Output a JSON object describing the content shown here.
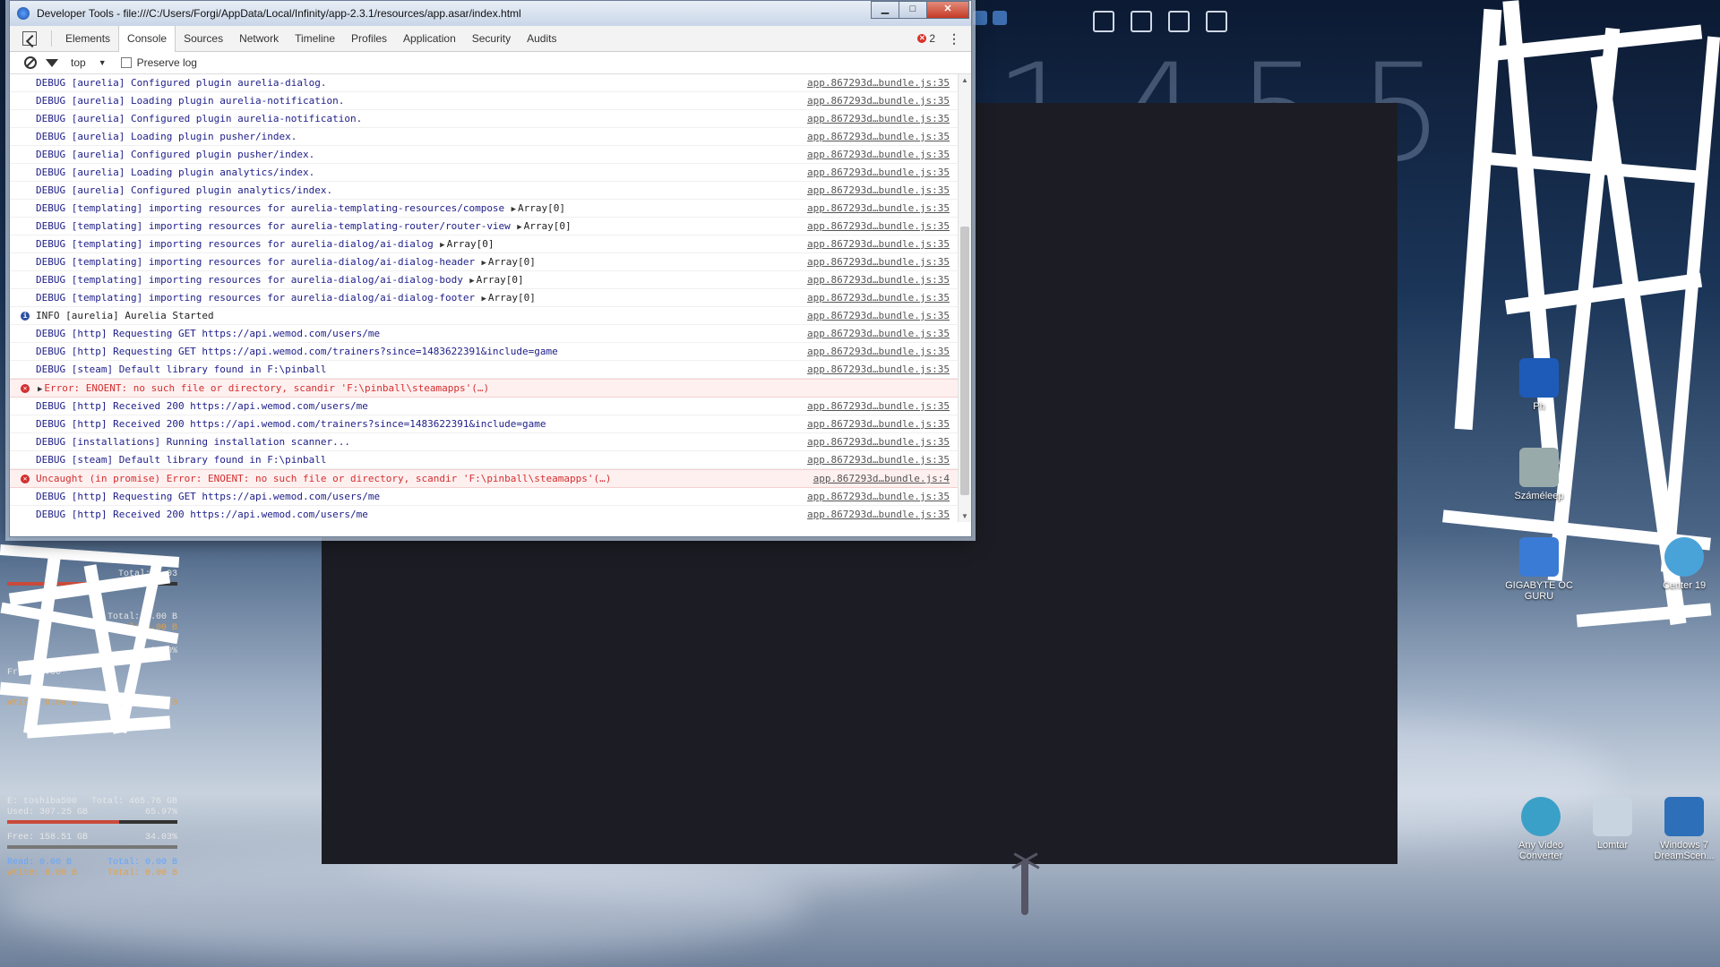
{
  "devtools": {
    "title": "Developer Tools - file:///C:/Users/Forgi/AppData/Local/Infinity/app-2.3.1/resources/app.asar/index.html",
    "window_buttons": {
      "minimize": "▁",
      "maximize": "□",
      "close": "✕"
    },
    "tabs": [
      {
        "label": "Elements"
      },
      {
        "label": "Console",
        "active": true
      },
      {
        "label": "Sources"
      },
      {
        "label": "Network"
      },
      {
        "label": "Timeline"
      },
      {
        "label": "Profiles"
      },
      {
        "label": "Application"
      },
      {
        "label": "Security"
      },
      {
        "label": "Audits"
      }
    ],
    "error_count": "2",
    "filter": {
      "context": "top",
      "preserve_log_label": "Preserve log"
    },
    "logs": [
      {
        "type": "debug",
        "text": "DEBUG [aurelia] Configured plugin aurelia-dialog.",
        "source": "app.867293d…bundle.js:35"
      },
      {
        "type": "debug",
        "text": "DEBUG [aurelia] Loading plugin aurelia-notification.",
        "source": "app.867293d…bundle.js:35"
      },
      {
        "type": "debug",
        "text": "DEBUG [aurelia] Configured plugin aurelia-notification.",
        "source": "app.867293d…bundle.js:35"
      },
      {
        "type": "debug",
        "text": "DEBUG [aurelia] Loading plugin pusher/index.",
        "source": "app.867293d…bundle.js:35"
      },
      {
        "type": "debug",
        "text": "DEBUG [aurelia] Configured plugin pusher/index.",
        "source": "app.867293d…bundle.js:35"
      },
      {
        "type": "debug",
        "text": "DEBUG [aurelia] Loading plugin analytics/index.",
        "source": "app.867293d…bundle.js:35"
      },
      {
        "type": "debug",
        "text": "DEBUG [aurelia] Configured plugin analytics/index.",
        "source": "app.867293d…bundle.js:35"
      },
      {
        "type": "debug",
        "text": "DEBUG [templating] importing resources for aurelia-templating-resources/compose",
        "extra": "Array[0]",
        "source": "app.867293d…bundle.js:35"
      },
      {
        "type": "debug",
        "text": "DEBUG [templating] importing resources for aurelia-templating-router/router-view",
        "extra": "Array[0]",
        "source": "app.867293d…bundle.js:35"
      },
      {
        "type": "debug",
        "text": "DEBUG [templating] importing resources for aurelia-dialog/ai-dialog",
        "extra": "Array[0]",
        "source": "app.867293d…bundle.js:35"
      },
      {
        "type": "debug",
        "text": "DEBUG [templating] importing resources for aurelia-dialog/ai-dialog-header",
        "extra": "Array[0]",
        "source": "app.867293d…bundle.js:35"
      },
      {
        "type": "debug",
        "text": "DEBUG [templating] importing resources for aurelia-dialog/ai-dialog-body",
        "extra": "Array[0]",
        "source": "app.867293d…bundle.js:35"
      },
      {
        "type": "debug",
        "text": "DEBUG [templating] importing resources for aurelia-dialog/ai-dialog-footer",
        "extra": "Array[0]",
        "source": "app.867293d…bundle.js:35"
      },
      {
        "type": "info",
        "text": "INFO [aurelia] Aurelia Started",
        "source": "app.867293d…bundle.js:35"
      },
      {
        "type": "debug",
        "text": "DEBUG [http] Requesting GET https://api.wemod.com/users/me",
        "source": "app.867293d…bundle.js:35"
      },
      {
        "type": "debug",
        "text": "DEBUG [http] Requesting GET https://api.wemod.com/trainers?since=1483622391&include=game",
        "source": "app.867293d…bundle.js:35"
      },
      {
        "type": "debug",
        "text": "DEBUG [steam] Default library found in F:\\pinball",
        "source": "app.867293d…bundle.js:35"
      },
      {
        "type": "error",
        "expandable": true,
        "text": "Error: ENOENT: no such file or directory, scandir 'F:\\pinball\\steamapps'(…)",
        "source": ""
      },
      {
        "type": "debug",
        "text": "DEBUG [http] Received 200 https://api.wemod.com/users/me",
        "source": "app.867293d…bundle.js:35"
      },
      {
        "type": "debug",
        "text": "DEBUG [http] Received 200 https://api.wemod.com/trainers?since=1483622391&include=game",
        "source": "app.867293d…bundle.js:35"
      },
      {
        "type": "debug",
        "text": "DEBUG [installations] Running installation scanner...",
        "source": "app.867293d…bundle.js:35"
      },
      {
        "type": "debug",
        "text": "DEBUG [steam] Default library found in F:\\pinball",
        "source": "app.867293d…bundle.js:35"
      },
      {
        "type": "error",
        "text": "Uncaught (in promise) Error: ENOENT: no such file or directory, scandir 'F:\\pinball\\steamapps'(…)",
        "source": "app.867293d…bundle.js:4"
      },
      {
        "type": "debug",
        "text": "DEBUG [http] Requesting GET https://api.wemod.com/users/me",
        "source": "app.867293d…bundle.js:35"
      },
      {
        "type": "debug",
        "text": "DEBUG [http] Received 200 ",
        "link": "https://api.wemod.com/users/me",
        "source": "app.867293d…bundle.js:35"
      }
    ],
    "prompt": "›"
  },
  "desktop": {
    "clock": "1455",
    "drive_gadget": {
      "drive": "E: toshiba500",
      "total": "Total: 465.76 GB",
      "used": "Used: 307.25 GB",
      "used_pct": "65.97%",
      "used_fraction": 0.66,
      "free": "Free: 158.51 GB",
      "free_pct": "34.03%",
      "read": "Read: 0.00 B",
      "read_total": "Total: 0.00 B",
      "write": "Write: 0.00 B",
      "write_total": "Total: 0.00 B"
    },
    "upper_gadget": {
      "total_top": "Total: 1.03",
      "total_b1": "Total: 0.00 B",
      "total_b2": "Total: 0.00 B",
      "pct": "0.00%",
      "free": "Free: 0.00",
      "total_b3": "Total: 0.00 B",
      "write": "Write: 0.00 B"
    },
    "icons": [
      {
        "label": "Ph",
        "color": "#1e5bb8"
      },
      {
        "label": "Száméleep",
        "color": "#9aa"
      },
      {
        "label": "GIGABYTE OC GURU",
        "color": "#3a7bd5"
      },
      {
        "label": "Center 19",
        "color": "#4aa3d8"
      },
      {
        "label": "Any Video Converter",
        "color": "#3aa0c8"
      },
      {
        "label": "Lomtár",
        "color": "#c8d4e0"
      },
      {
        "label": "Windows 7 DreamScen...",
        "color": "#2d6fb8"
      }
    ]
  }
}
